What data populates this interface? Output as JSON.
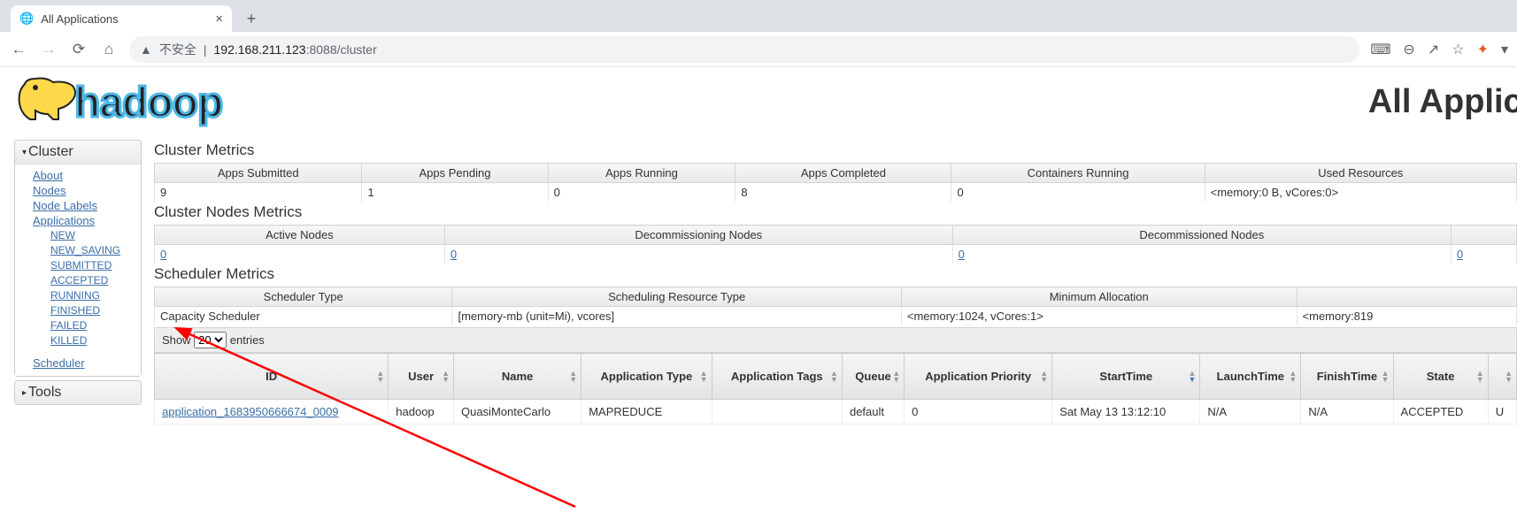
{
  "browser": {
    "tab_title": "All Applications",
    "security_label": "不安全",
    "url_host": "192.168.211.123",
    "url_port_path": ":8088/cluster"
  },
  "page": {
    "logo_word": "hadoop",
    "title": "All Applicati"
  },
  "sidebar": {
    "cluster_header": "Cluster",
    "tools_header": "Tools",
    "links": {
      "about": "About",
      "nodes": "Nodes",
      "node_labels": "Node Labels",
      "applications": "Applications",
      "scheduler": "Scheduler"
    },
    "app_states": [
      "NEW",
      "NEW_SAVING",
      "SUBMITTED",
      "ACCEPTED",
      "RUNNING",
      "FINISHED",
      "FAILED",
      "KILLED"
    ]
  },
  "cluster_metrics": {
    "heading": "Cluster Metrics",
    "headers": [
      "Apps Submitted",
      "Apps Pending",
      "Apps Running",
      "Apps Completed",
      "Containers Running",
      "Used Resources"
    ],
    "values": [
      "9",
      "1",
      "0",
      "8",
      "0",
      "<memory:0 B, vCores:0>"
    ]
  },
  "nodes_metrics": {
    "heading": "Cluster Nodes Metrics",
    "headers": [
      "Active Nodes",
      "Decommissioning Nodes",
      "Decommissioned Nodes",
      ""
    ],
    "values": [
      "0",
      "0",
      "0",
      "0"
    ]
  },
  "scheduler_metrics": {
    "heading": "Scheduler Metrics",
    "headers": [
      "Scheduler Type",
      "Scheduling Resource Type",
      "Minimum Allocation",
      ""
    ],
    "values": [
      "Capacity Scheduler",
      "[memory-mb (unit=Mi), vcores]",
      "<memory:1024, vCores:1>",
      "<memory:819"
    ]
  },
  "apps_table": {
    "show_label_prefix": "Show",
    "show_label_suffix": "entries",
    "show_value": "20",
    "columns": [
      "ID",
      "User",
      "Name",
      "Application Type",
      "Application Tags",
      "Queue",
      "Application Priority",
      "StartTime",
      "LaunchTime",
      "FinishTime",
      "State",
      ""
    ],
    "sort_column": "StartTime",
    "rows": [
      {
        "id": "application_1683950666674_0009",
        "user": "hadoop",
        "name": "QuasiMonteCarlo",
        "app_type": "MAPREDUCE",
        "tags": "",
        "queue": "default",
        "priority": "0",
        "start_time": "Sat May 13 13:12:10",
        "launch_time": "N/A",
        "finish_time": "N/A",
        "state": "ACCEPTED",
        "trail": "U"
      }
    ]
  }
}
